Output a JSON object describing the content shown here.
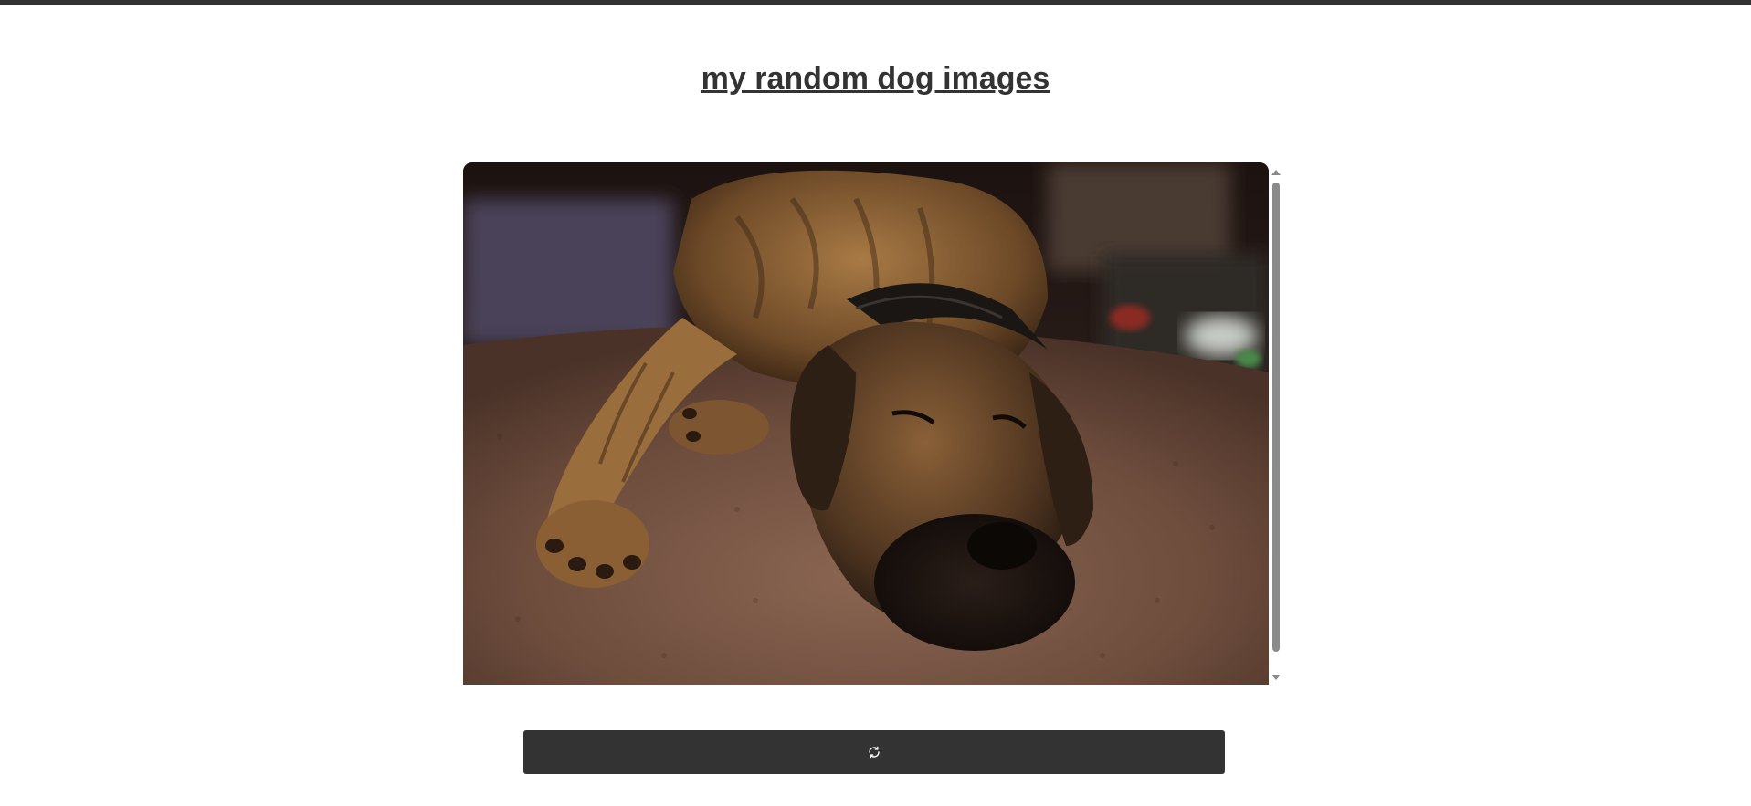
{
  "page": {
    "title": "my random dog images"
  },
  "gallery": {
    "image_subject": "sleeping brindle great dane on a brown shag rug",
    "scroll_position": 0.0
  },
  "refresh": {
    "icon": "refresh-icon"
  },
  "colors": {
    "accent": "#333333",
    "background": "#ffffff"
  }
}
